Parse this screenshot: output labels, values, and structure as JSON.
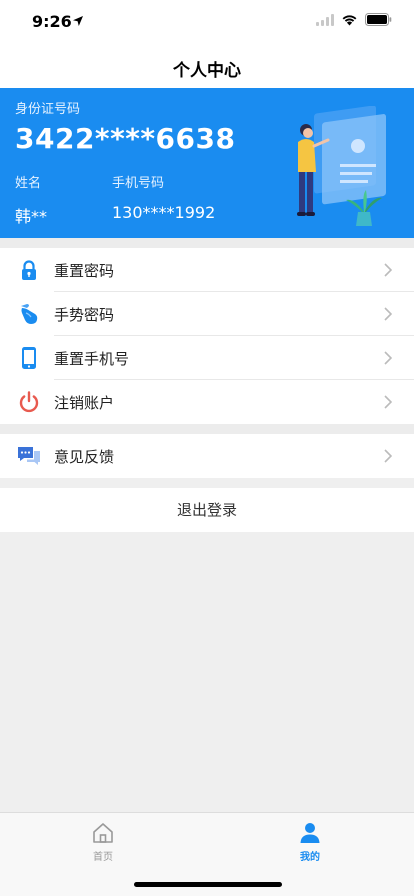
{
  "status_bar": {
    "time": "9:26"
  },
  "nav": {
    "title": "个人中心"
  },
  "card": {
    "id_label": "身份证号码",
    "id_number": "3422****6638",
    "name_label": "姓名",
    "name_value": "韩**",
    "phone_label": "手机号码",
    "phone_value": "130****1992",
    "background_color": "#1a8cf0"
  },
  "menu": {
    "items": [
      {
        "label": "重置密码",
        "icon": "lock-icon",
        "color": "#1a8cf0"
      },
      {
        "label": "手势密码",
        "icon": "gesture-hand-icon",
        "color": "#1a8cf0"
      },
      {
        "label": "重置手机号",
        "icon": "phone-icon",
        "color": "#1a8cf0"
      },
      {
        "label": "注销账户",
        "icon": "power-icon",
        "color": "#e85a4f"
      }
    ],
    "feedback": {
      "label": "意见反馈",
      "icon": "chat-bubble-icon",
      "color": "#3a72d8"
    },
    "logout": "退出登录"
  },
  "tabbar": {
    "tabs": [
      {
        "label": "首页",
        "icon": "home-icon",
        "active": false
      },
      {
        "label": "我的",
        "icon": "person-icon",
        "active": true
      }
    ],
    "active_color": "#1a8cf0",
    "inactive_color": "#999999"
  }
}
